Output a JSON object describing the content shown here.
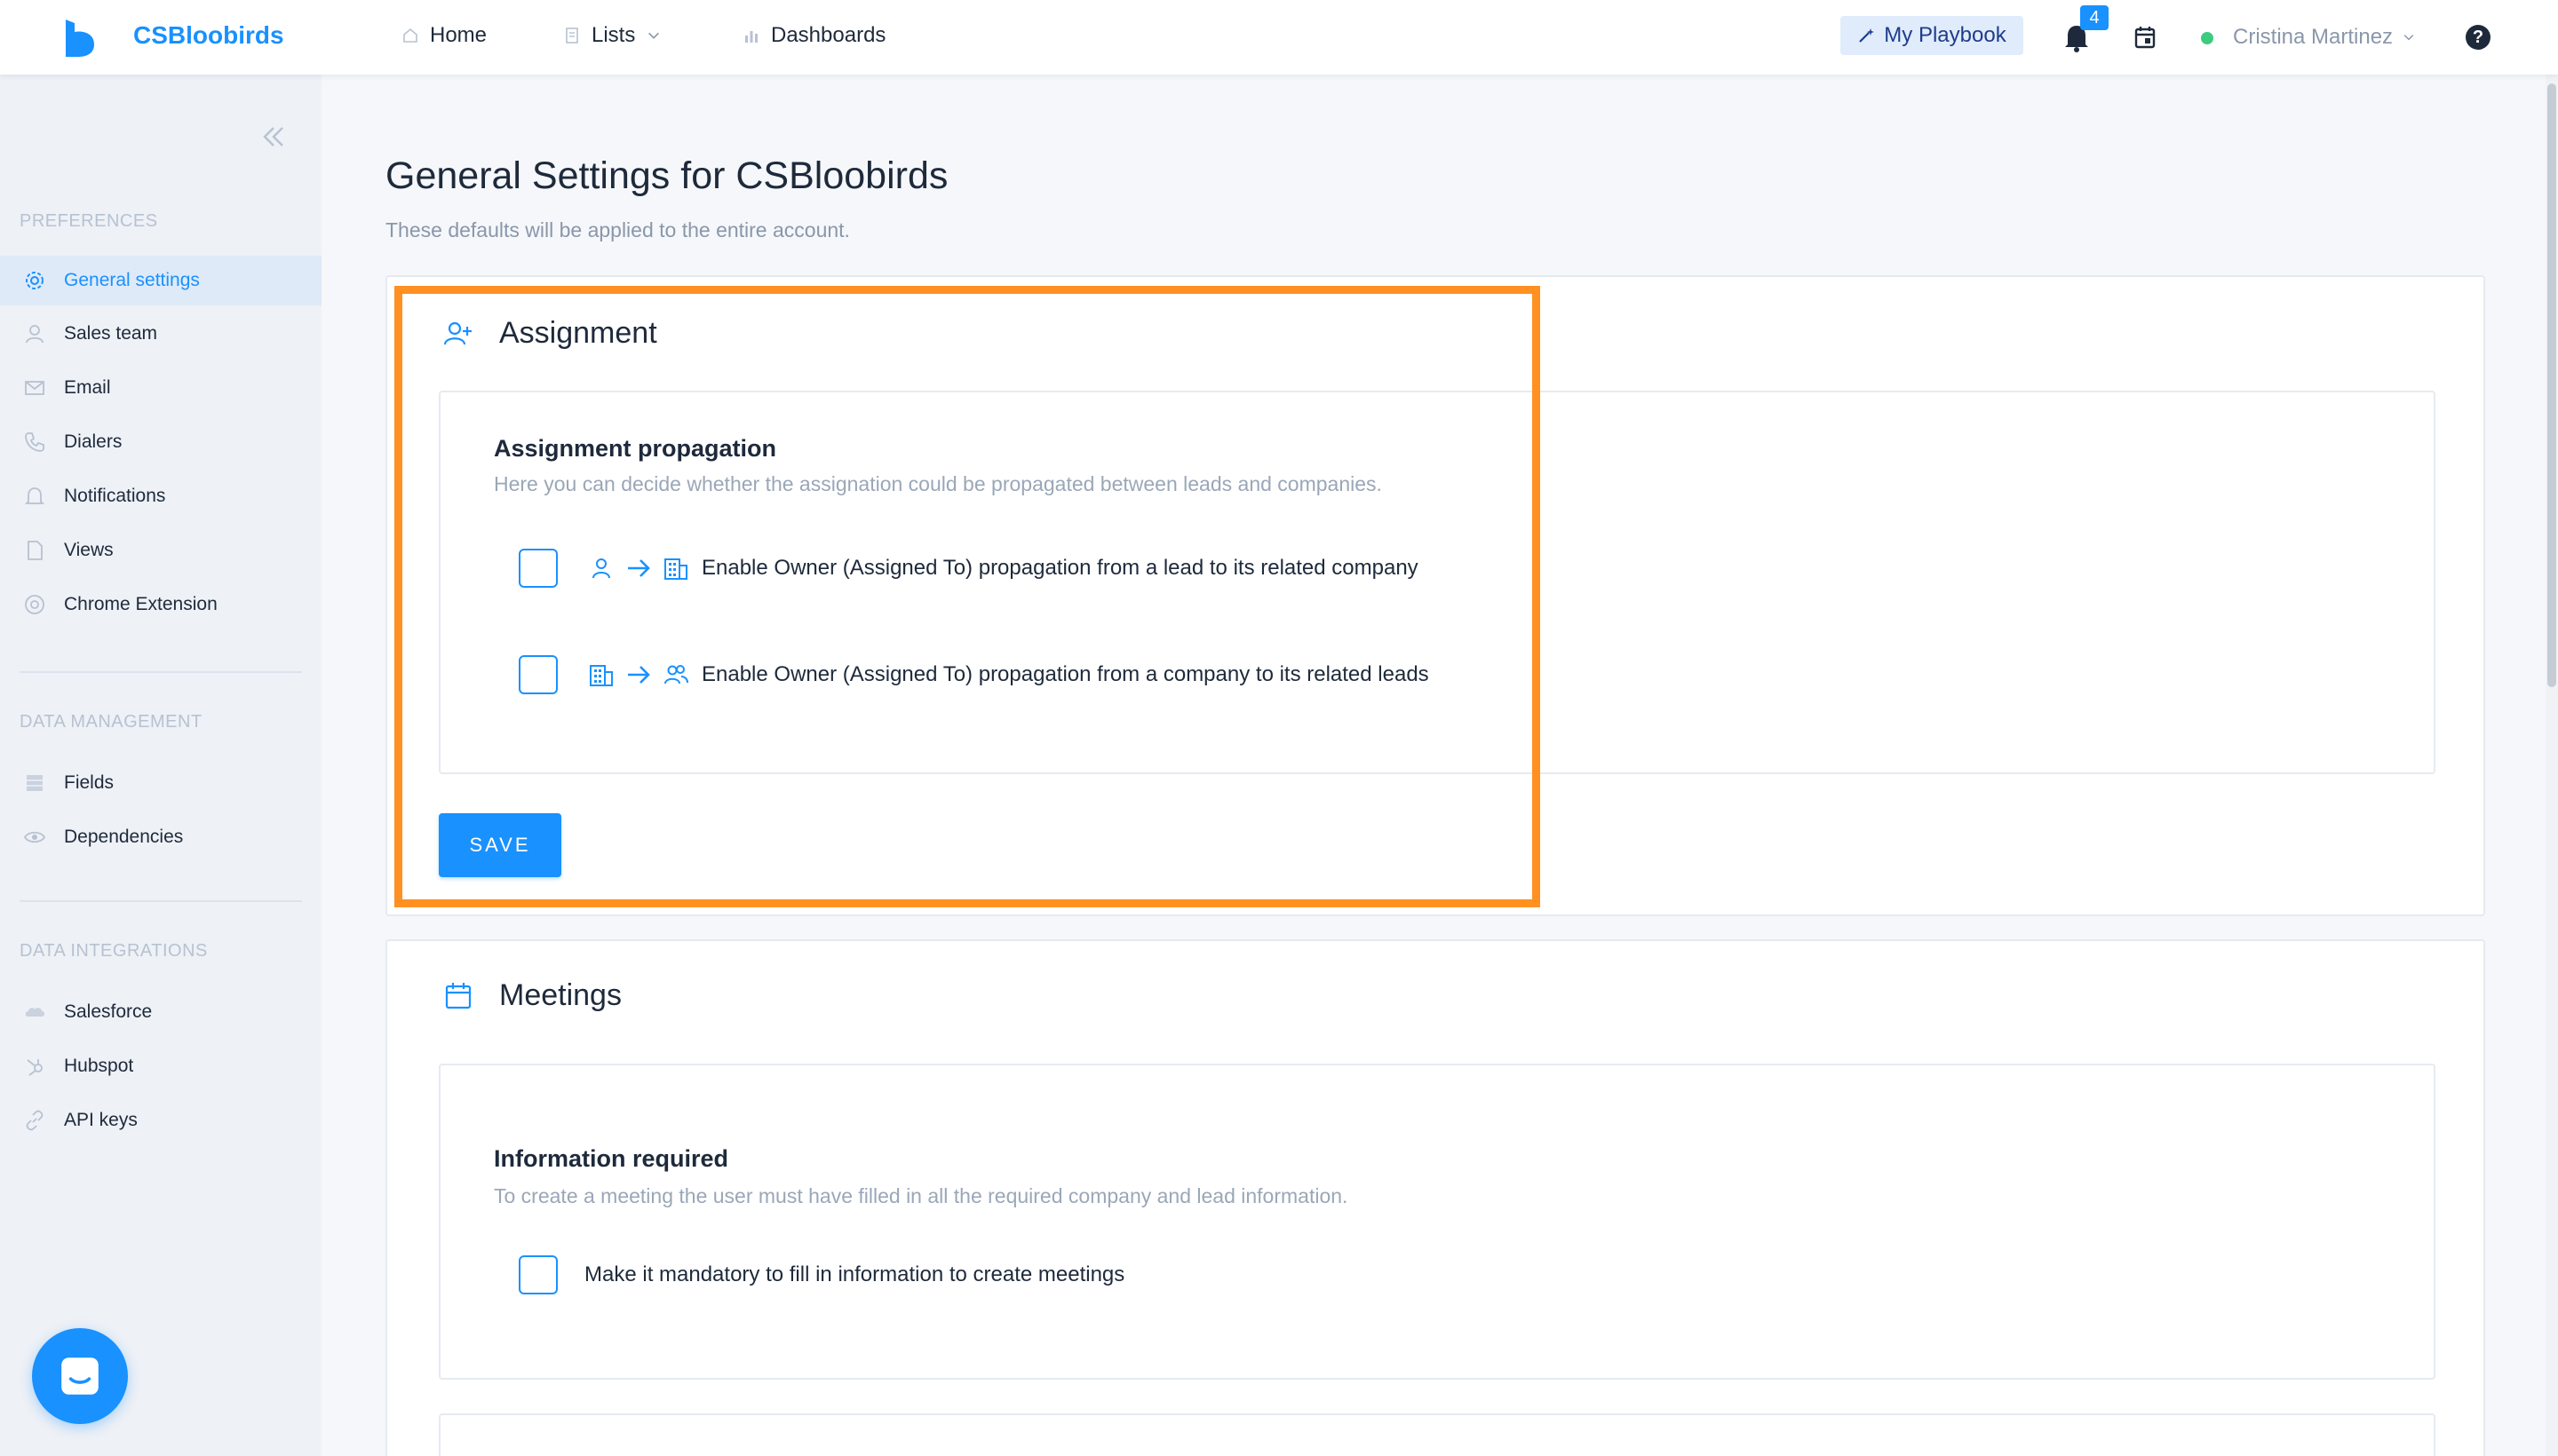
{
  "topbar": {
    "brand": "CSBloobirds",
    "nav": [
      {
        "label": "Home",
        "icon": "home-icon"
      },
      {
        "label": "Lists",
        "icon": "list-icon"
      },
      {
        "label": "Dashboards",
        "icon": "bar-chart-icon"
      }
    ],
    "playbook_label": "My Playbook",
    "notification_count": "4",
    "user_name": "Cristina Martinez",
    "help_label": "?",
    "colors": {
      "brand": "#1991ff",
      "status_online": "#3ccb7f"
    }
  },
  "sidebar": {
    "sections": [
      {
        "title": "PREFERENCES"
      },
      {
        "title": "DATA MANAGEMENT"
      },
      {
        "title": "DATA INTEGRATIONS"
      }
    ],
    "preferences": [
      {
        "label": "General settings",
        "icon": "gear-icon",
        "active": true
      },
      {
        "label": "Sales team",
        "icon": "user-icon"
      },
      {
        "label": "Email",
        "icon": "mail-icon"
      },
      {
        "label": "Dialers",
        "icon": "phone-icon"
      },
      {
        "label": "Notifications",
        "icon": "bell-icon"
      },
      {
        "label": "Views",
        "icon": "document-icon"
      },
      {
        "label": "Chrome Extension",
        "icon": "chrome-icon"
      }
    ],
    "data_management": [
      {
        "label": "Fields",
        "icon": "fields-icon"
      },
      {
        "label": "Dependencies",
        "icon": "eye-icon"
      }
    ],
    "data_integrations": [
      {
        "label": "Salesforce",
        "icon": "salesforce-cloud-icon"
      },
      {
        "label": "Hubspot",
        "icon": "hubspot-icon"
      },
      {
        "label": "API keys",
        "icon": "link-icon"
      }
    ]
  },
  "main": {
    "title": "General Settings for CSBloobirds",
    "subtitle": "These defaults will be applied to the entire account.",
    "assignment": {
      "heading": "Assignment",
      "section_title": "Assignment propagation",
      "section_desc": "Here you can decide whether the assignation could be propagated between leads and companies.",
      "options": [
        {
          "label": "Enable Owner (Assigned To) propagation from a lead to its related company",
          "checked": false
        },
        {
          "label": "Enable Owner (Assigned To) propagation from a company to its related leads",
          "checked": false
        }
      ],
      "save_label": "SAVE"
    },
    "meetings": {
      "heading": "Meetings",
      "section_title": "Information required",
      "section_desc": "To create a meeting the user must have filled in all the required company and lead information.",
      "options": [
        {
          "label": "Make it mandatory to fill in information to create meetings",
          "checked": false
        }
      ]
    },
    "highlight_color": "#ff9021"
  }
}
